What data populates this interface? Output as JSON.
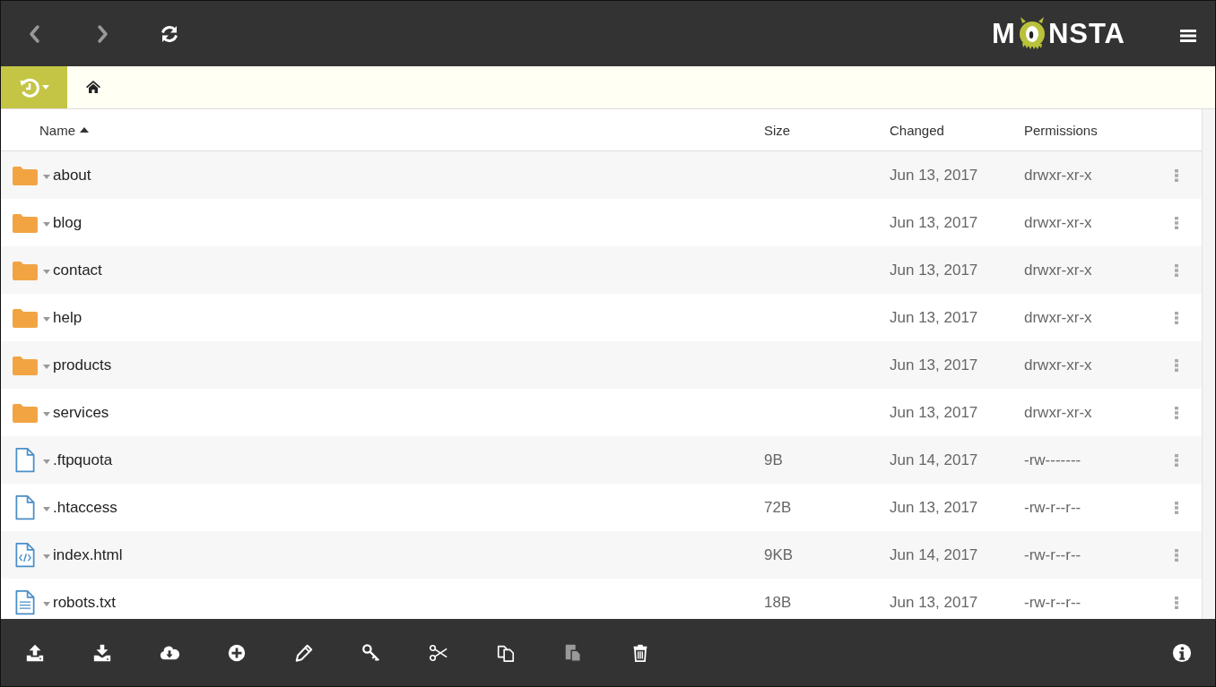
{
  "nav": {
    "buttons": [
      {
        "kind": "back",
        "disabled": true
      },
      {
        "kind": "forward",
        "disabled": true
      },
      {
        "kind": "refresh",
        "disabled": false
      }
    ]
  },
  "logo": {
    "before": "M",
    "after": "NSTA"
  },
  "table": {
    "columns": [
      {
        "label": "Name",
        "sorted": true,
        "ascending": true
      },
      {
        "label": "Size",
        "sorted": false
      },
      {
        "label": "Changed",
        "sorted": false
      },
      {
        "label": "Permissions",
        "sorted": false
      }
    ],
    "rows": [
      {
        "kind": "folder",
        "name": "about",
        "changed": "Jun 13, 2017",
        "permissions": "drwxr-xr-x"
      },
      {
        "kind": "folder",
        "name": "blog",
        "changed": "Jun 13, 2017",
        "permissions": "drwxr-xr-x"
      },
      {
        "kind": "folder",
        "name": "contact",
        "changed": "Jun 13, 2017",
        "permissions": "drwxr-xr-x"
      },
      {
        "kind": "folder",
        "name": "help",
        "changed": "Jun 13, 2017",
        "permissions": "drwxr-xr-x"
      },
      {
        "kind": "folder",
        "name": "products",
        "changed": "Jun 13, 2017",
        "permissions": "drwxr-xr-x"
      },
      {
        "kind": "folder",
        "name": "services",
        "changed": "Jun 13, 2017",
        "permissions": "drwxr-xr-x"
      },
      {
        "kind": "file",
        "name": ".ftpquota",
        "size": "9B",
        "changed": "Jun 14, 2017",
        "permissions": "-rw-------"
      },
      {
        "kind": "file",
        "name": ".htaccess",
        "size": "72B",
        "changed": "Jun 13, 2017",
        "permissions": "-rw-r--r--"
      },
      {
        "kind": "code",
        "name": "index.html",
        "size": "9KB",
        "changed": "Jun 14, 2017",
        "permissions": "-rw-r--r--"
      },
      {
        "kind": "text",
        "name": "robots.txt",
        "size": "18B",
        "changed": "Jun 13, 2017",
        "permissions": "-rw-r--r--"
      }
    ]
  },
  "toolbar": {
    "buttons": [
      {
        "kind": "upload",
        "disabled": false
      },
      {
        "kind": "download",
        "disabled": false
      },
      {
        "kind": "cloud-download",
        "disabled": false
      },
      {
        "kind": "new",
        "disabled": false
      },
      {
        "kind": "rename",
        "disabled": false
      },
      {
        "kind": "permissions",
        "disabled": false
      },
      {
        "kind": "cut",
        "disabled": false
      },
      {
        "kind": "copy",
        "disabled": false
      },
      {
        "kind": "paste",
        "disabled": true
      },
      {
        "kind": "delete",
        "disabled": false
      },
      {
        "kind": "info",
        "disabled": false
      }
    ]
  }
}
